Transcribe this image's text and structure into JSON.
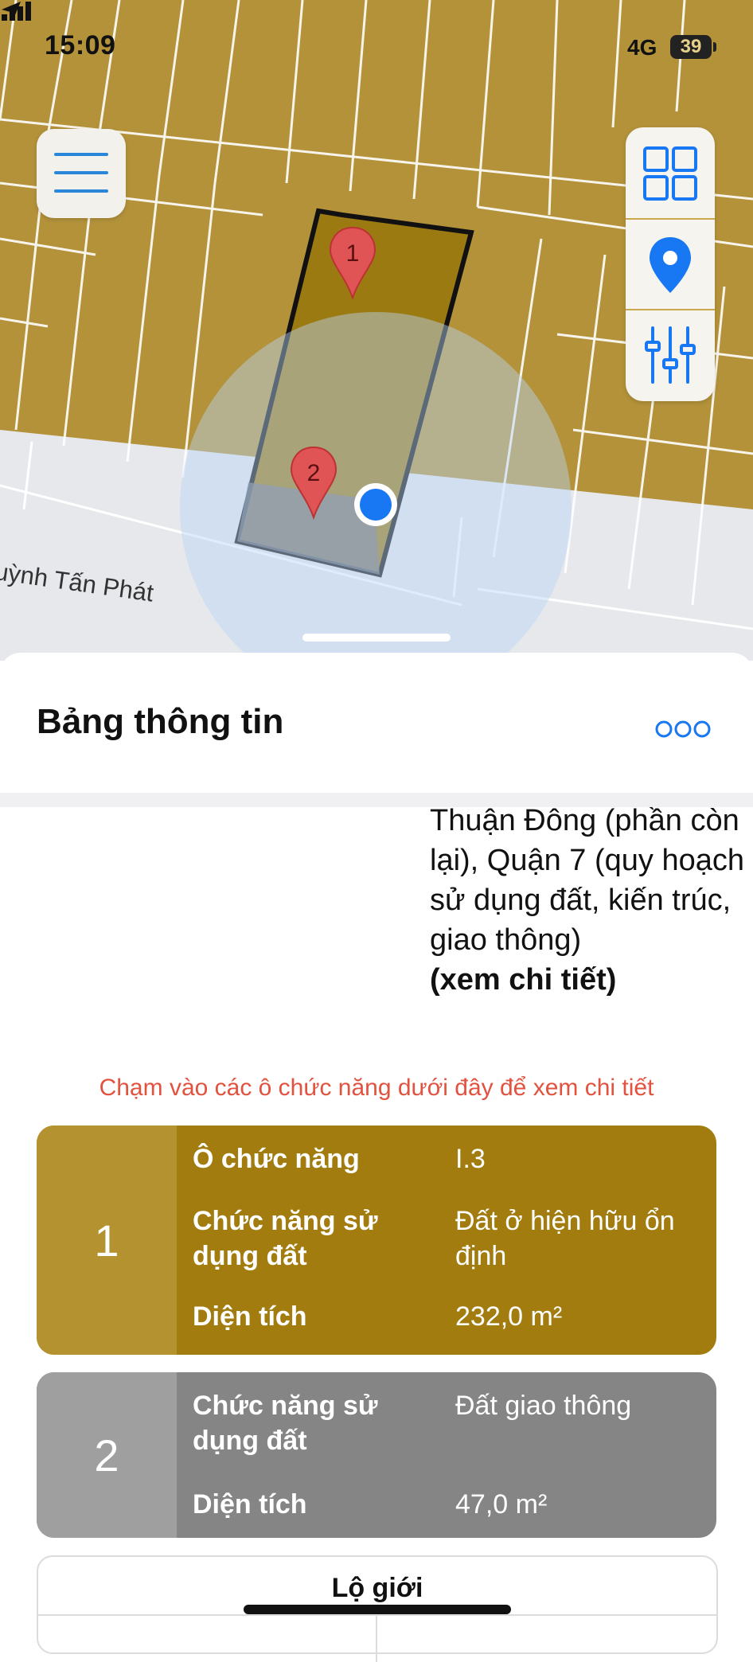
{
  "status_bar": {
    "time": "15:09",
    "network": "4G",
    "battery": "39"
  },
  "map": {
    "street_name": "uỳnh Tấn Phát",
    "markers": [
      "1",
      "2"
    ],
    "colors": {
      "land": "#b3923a",
      "parcel": "#9c7a12",
      "road": "#e7e8ec",
      "user_location": "#1877f2",
      "accent": "#2a86d9"
    },
    "icons": [
      "menu-icon",
      "grid-icon",
      "location-pin-icon",
      "filter-sliders-icon"
    ]
  },
  "sheet": {
    "title": "Bảng thông tin",
    "description": "Thuận Đông (phần còn lại), Quận 7 (quy hoạch sử dụng đất, kiến trúc, giao thông)",
    "detail_link": "(xem chi tiết)",
    "hint": "Chạm vào các ô chức năng dưới đây để xem chi tiết"
  },
  "cards": [
    {
      "number": "1",
      "color": "#a37c0f",
      "rows": [
        {
          "label": "Ô chức năng",
          "value": "I.3"
        },
        {
          "label": "Chức năng sử dụng đất",
          "value": "Đất ở hiện hữu ổn định"
        },
        {
          "label": "Diện tích",
          "value": "232,0 m²"
        }
      ]
    },
    {
      "number": "2",
      "color": "#858585",
      "rows": [
        {
          "label": "Chức năng sử dụng đất",
          "value": "Đất giao thông"
        },
        {
          "label": "Diện tích",
          "value": "47,0 m²"
        }
      ]
    }
  ],
  "road_table": {
    "title": "Lộ giới"
  }
}
